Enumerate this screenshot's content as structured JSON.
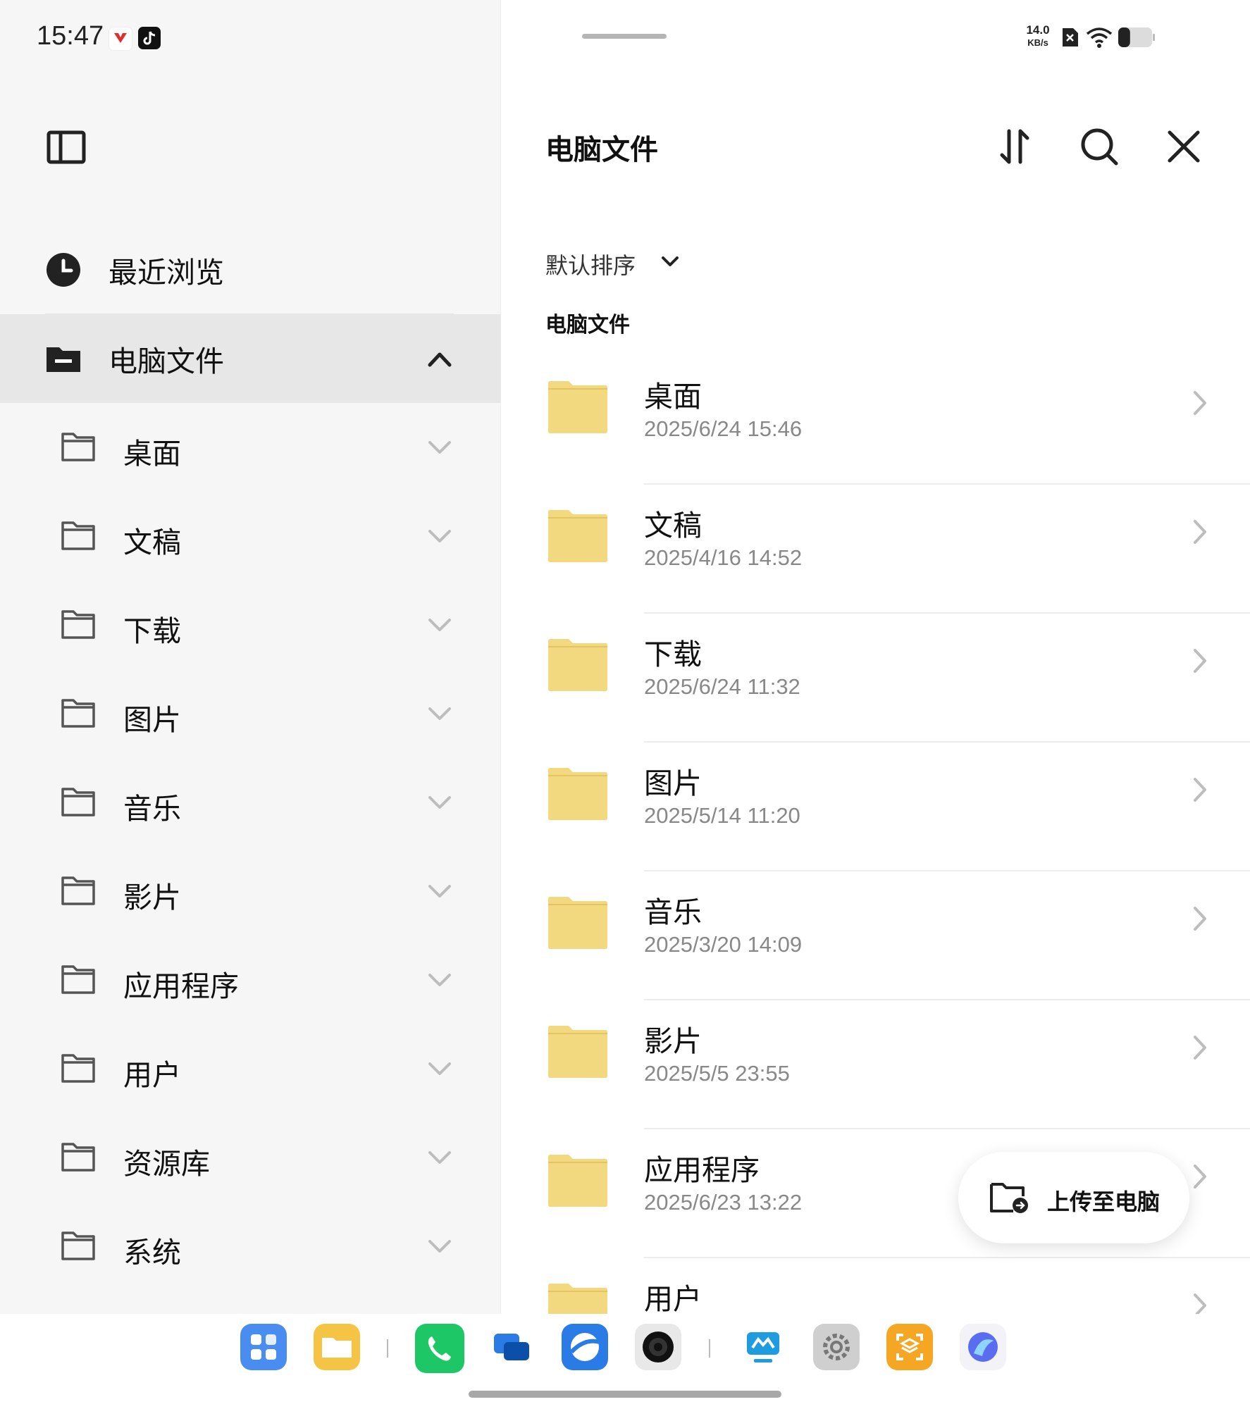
{
  "status_bar": {
    "time": "15:47",
    "net_speed_value": "14.0",
    "net_speed_unit": "KB/s",
    "battery_level": 0.35
  },
  "sidebar": {
    "toggle_icon": "sidebar-panel-icon",
    "recent": {
      "label": "最近浏览",
      "icon": "clock-icon"
    },
    "computer_files": {
      "label": "电脑文件",
      "icon": "folder-icon",
      "expanded": true
    },
    "folders": [
      {
        "label": "桌面"
      },
      {
        "label": "文稿"
      },
      {
        "label": "下载"
      },
      {
        "label": "图片"
      },
      {
        "label": "音乐"
      },
      {
        "label": "影片"
      },
      {
        "label": "应用程序"
      },
      {
        "label": "用户"
      },
      {
        "label": "资源库"
      },
      {
        "label": "系统"
      }
    ]
  },
  "main": {
    "title": "电脑文件",
    "sort_label": "默认排序",
    "section_label": "电脑文件",
    "items": [
      {
        "name": "桌面",
        "date": "2025/6/24 15:46"
      },
      {
        "name": "文稿",
        "date": "2025/4/16 14:52"
      },
      {
        "name": "下载",
        "date": "2025/6/24 11:32"
      },
      {
        "name": "图片",
        "date": "2025/5/14 11:20"
      },
      {
        "name": "音乐",
        "date": "2025/3/20 14:09"
      },
      {
        "name": "影片",
        "date": "2025/5/5 23:55"
      },
      {
        "name": "应用程序",
        "date": "2025/6/23 13:22"
      },
      {
        "name": "用户",
        "date": ""
      }
    ],
    "upload_button": "上传至电脑"
  },
  "colors": {
    "folder_yellow": "#f2d87e",
    "sidebar_bg": "#f6f6f6",
    "selected_bg": "#e7e7e7"
  },
  "dock": {
    "apps": [
      "app-grid-icon",
      "files-app-icon",
      "phone-icon",
      "chat-app-icon",
      "browser-icon",
      "camera-icon",
      "remote-desktop-icon",
      "settings-icon",
      "screenshot-icon",
      "assistant-icon"
    ]
  }
}
